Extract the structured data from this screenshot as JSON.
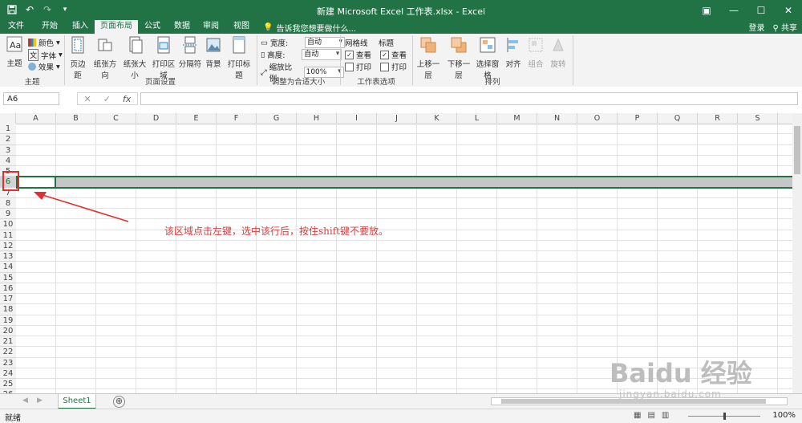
{
  "window": {
    "title": "新建 Microsoft Excel 工作表.xlsx - Excel",
    "controls": [
      "▣",
      "—",
      "☐",
      "✕"
    ]
  },
  "quick_access": {
    "save_icon": "save-icon",
    "undo_icon": "undo-icon",
    "redo_icon": "redo-icon"
  },
  "tabs": [
    "文件",
    "开始",
    "插入",
    "页面布局",
    "公式",
    "数据",
    "审阅",
    "视图"
  ],
  "active_tab": "页面布局",
  "tell_me": "告诉我您想要做什么...",
  "account": {
    "login": "登录",
    "share": "共享"
  },
  "ribbon": {
    "themes": {
      "theme": "主题",
      "colors": "颜色",
      "fonts": "字体",
      "effects": "效果",
      "group": "主题"
    },
    "page_setup": {
      "margins": "页边距",
      "orientation": "纸张方向",
      "size": "纸张大小",
      "print_area": "打印区域",
      "breaks": "分隔符",
      "background": "背景",
      "print_titles": "打印标题",
      "group": "页面设置"
    },
    "scale": {
      "width_label": "宽度:",
      "width_value": "自动",
      "height_label": "高度:",
      "height_value": "自动",
      "scale_label": "缩放比例:",
      "scale_value": "100%",
      "group": "调整为合适大小"
    },
    "sheet_options": {
      "gridlines": "网格线",
      "headings": "标题",
      "view": "查看",
      "print": "打印",
      "group": "工作表选项"
    },
    "arrange": {
      "bring_forward": "上移一层",
      "send_backward": "下移一层",
      "selection_pane": "选择窗格",
      "align": "对齐",
      "group_btn": "组合",
      "rotate": "旋转",
      "group": "排列"
    }
  },
  "formula_bar": {
    "name_box": "A6",
    "cancel": "✕",
    "enter": "✓",
    "fx": "fx",
    "value": ""
  },
  "columns": [
    "A",
    "B",
    "C",
    "D",
    "E",
    "F",
    "G",
    "H",
    "I",
    "J",
    "K",
    "L",
    "M",
    "N",
    "O",
    "P",
    "Q",
    "R",
    "S"
  ],
  "rows": [
    "1",
    "2",
    "3",
    "4",
    "5",
    "6",
    "7",
    "8",
    "9",
    "10",
    "11",
    "12",
    "13",
    "14",
    "15",
    "16",
    "17",
    "18",
    "19",
    "20",
    "21",
    "22",
    "23",
    "24",
    "25",
    "26"
  ],
  "annotation": "该区域点击左键，选中该行后，按住shift键不要放。",
  "sheets": [
    "Sheet1"
  ],
  "add_sheet": "⊕",
  "status": {
    "ready": "就绪",
    "zoom": "100%"
  },
  "watermark": {
    "brand": "Baidu 经验",
    "url": "jingyan.baidu.com"
  },
  "colors": {
    "excel_green": "#217346",
    "annotation_red": "#d04040",
    "selection_gray": "#c6c6c6"
  }
}
